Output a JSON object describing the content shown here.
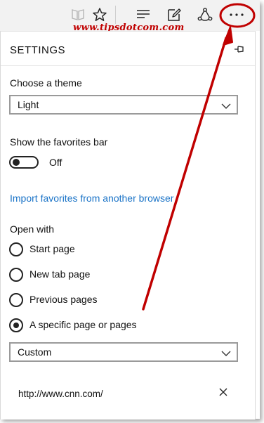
{
  "watermark": "www.tipsdotcom.com",
  "toolbar": {
    "icons": [
      "reading-view-icon",
      "favorites-star-icon",
      "hub-icon",
      "web-note-icon",
      "share-icon",
      "more-actions-icon"
    ]
  },
  "settings": {
    "title": "SETTINGS",
    "theme_label": "Choose a theme",
    "theme_value": "Light",
    "favorites_bar_label": "Show the favorites bar",
    "favorites_bar_state": "Off",
    "import_link": "Import favorites from another browser",
    "open_with_label": "Open with",
    "open_with_options": [
      {
        "label": "Start page",
        "selected": false
      },
      {
        "label": "New tab page",
        "selected": false
      },
      {
        "label": "Previous pages",
        "selected": false
      },
      {
        "label": "A specific page or pages",
        "selected": true
      }
    ],
    "page_select_value": "Custom",
    "custom_url": "http://www.cnn.com/"
  },
  "colors": {
    "annotation": "#c00000",
    "link": "#1a73c7"
  }
}
